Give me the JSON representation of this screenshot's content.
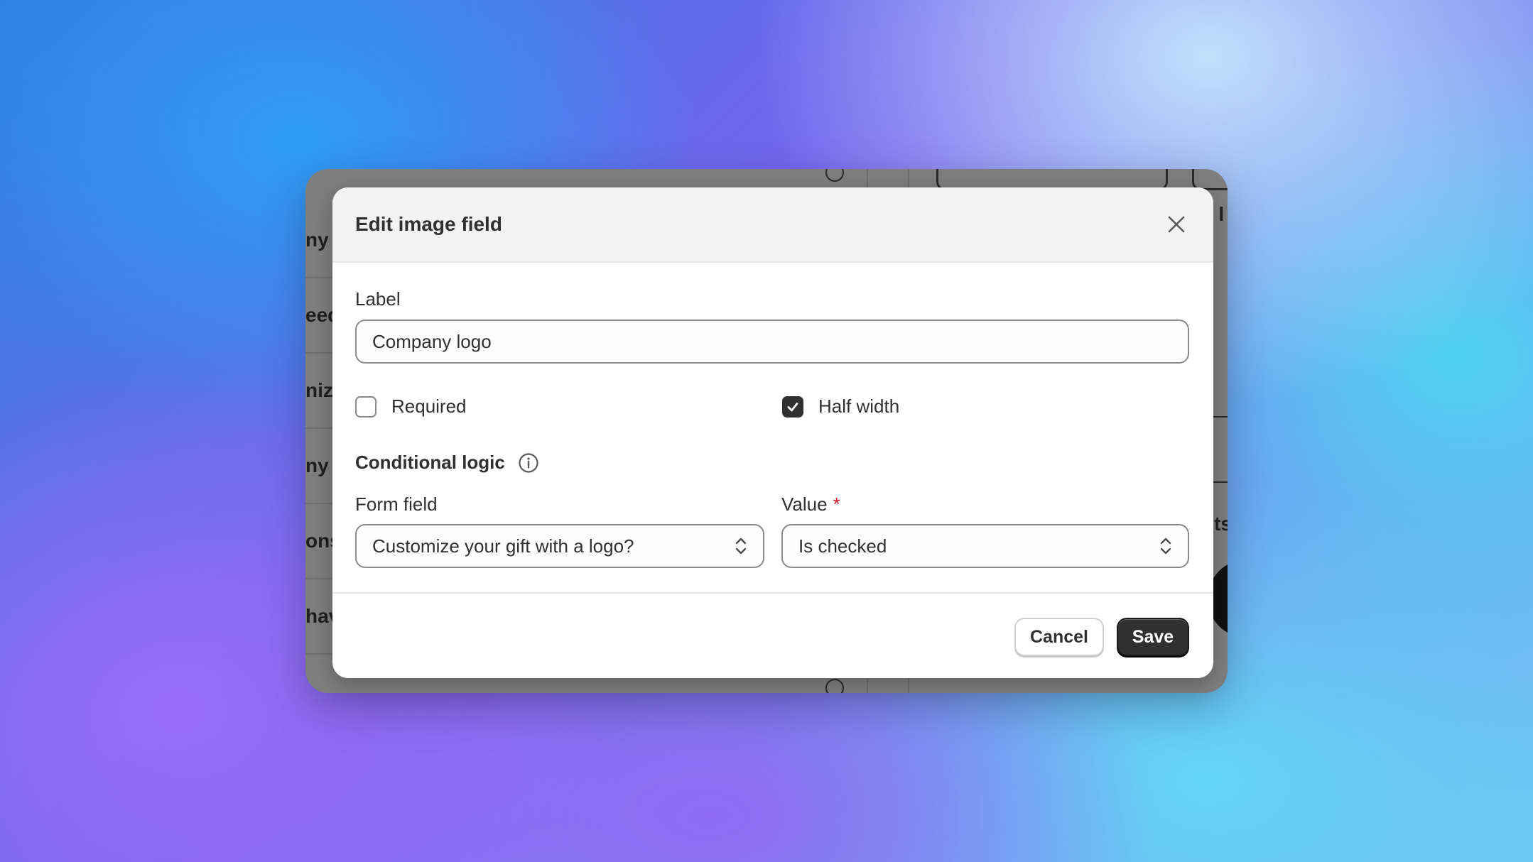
{
  "background_window": {
    "sidebar_snippets": [
      "ny",
      "eed",
      "nize",
      "ny l",
      "ons",
      "hav"
    ],
    "right_snippets": [
      "a l",
      "nts"
    ]
  },
  "modal": {
    "title": "Edit image field",
    "close_icon": "close-icon",
    "label_field": {
      "label": "Label",
      "value": "Company logo"
    },
    "required_checkbox": {
      "label": "Required",
      "checked": false
    },
    "half_width_checkbox": {
      "label": "Half width",
      "checked": true
    },
    "conditional_logic": {
      "title": "Conditional logic",
      "info_icon": "info-icon",
      "form_field": {
        "label": "Form field",
        "value": "Customize your gift with a logo?"
      },
      "value_field": {
        "label": "Value",
        "required_marker": "*",
        "value": "Is checked"
      }
    },
    "footer": {
      "cancel_label": "Cancel",
      "save_label": "Save"
    }
  },
  "colors": {
    "primary_button": "#303030",
    "required_star": "#c4102e",
    "header_bg": "#f2f2f2"
  }
}
